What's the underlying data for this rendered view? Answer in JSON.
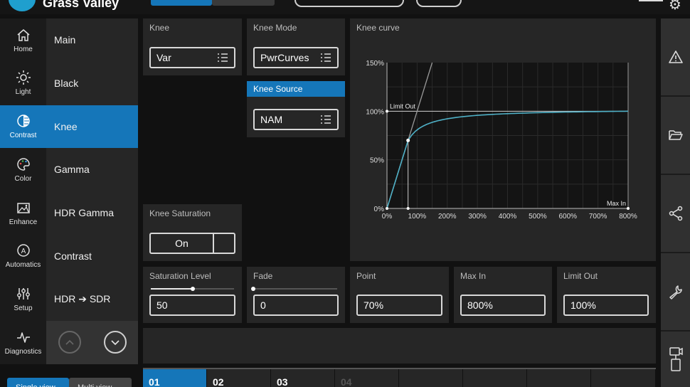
{
  "app": {
    "logo_text": "Grass Valley"
  },
  "colors": {
    "accent": "#1576b9",
    "panel": "#262626",
    "curve": "#4fb0c6"
  },
  "nav": {
    "items": [
      {
        "label": "Home",
        "icon": "home-icon"
      },
      {
        "label": "Light",
        "icon": "sun-icon"
      },
      {
        "label": "Contrast",
        "icon": "contrast-icon",
        "active": true
      },
      {
        "label": "Color",
        "icon": "palette-icon"
      },
      {
        "label": "Enhance",
        "icon": "image-enhance-icon"
      },
      {
        "label": "Automatics",
        "icon": "automatics-icon"
      },
      {
        "label": "Setup",
        "icon": "sliders-icon"
      },
      {
        "label": "Diagnostics",
        "icon": "pulse-icon"
      }
    ]
  },
  "submenu": {
    "items": [
      {
        "label": "Main"
      },
      {
        "label": "Black"
      },
      {
        "label": "Knee",
        "active": true
      },
      {
        "label": "Gamma"
      },
      {
        "label": "HDR Gamma"
      },
      {
        "label": "Contrast"
      },
      {
        "label": "HDR ➔ SDR"
      }
    ]
  },
  "knee": {
    "title": "Knee",
    "value": "Var"
  },
  "knee_mode": {
    "title": "Knee Mode",
    "value": "PwrCurves"
  },
  "knee_source": {
    "title": "Knee Source",
    "value": "NAM"
  },
  "knee_saturation": {
    "title": "Knee Saturation",
    "value": "On"
  },
  "saturation_level": {
    "title": "Saturation Level",
    "value": "50",
    "level": 0.5
  },
  "fade": {
    "title": "Fade",
    "value": "0",
    "level": 0
  },
  "point": {
    "title": "Point",
    "value": "70%"
  },
  "max_in": {
    "title": "Max In",
    "value": "800%"
  },
  "limit_out": {
    "title": "Limit Out",
    "value": "100%"
  },
  "chart_data": {
    "type": "line",
    "title": "Knee curve",
    "x_ticks": [
      "0%",
      "100%",
      "200%",
      "300%",
      "400%",
      "500%",
      "600%",
      "700%",
      "800%"
    ],
    "y_ticks": [
      "0%",
      "50%",
      "100%",
      "150%"
    ],
    "xlim": [
      0,
      800
    ],
    "ylim": [
      0,
      150
    ],
    "annotations": {
      "limit_out": "Limit Out",
      "max_in": "Max In"
    },
    "knee_point": {
      "x": 70,
      "y": 70
    },
    "limit_out_y": 100,
    "max_in_x": 800,
    "grid": true
  },
  "bottom": {
    "tabs": [
      {
        "label": "01",
        "active": true
      },
      {
        "label": "02"
      },
      {
        "label": "03"
      },
      {
        "label": "04",
        "dim": true
      }
    ],
    "mode_a": "Single view",
    "mode_b": "Multi view"
  }
}
